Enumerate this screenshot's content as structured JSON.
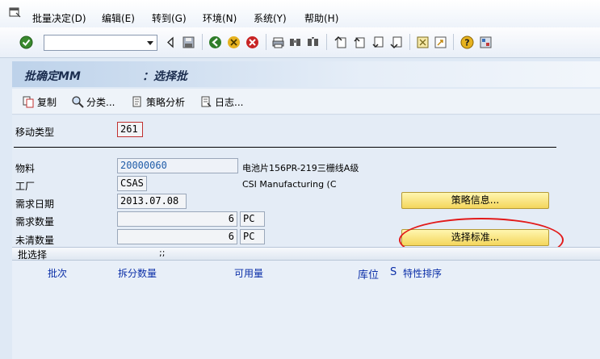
{
  "menu": {
    "items": [
      "批量决定(D)",
      "编辑(E)",
      "转到(G)",
      "环境(N)",
      "系统(Y)",
      "帮助(H)"
    ]
  },
  "toolbar": {
    "command_field": ""
  },
  "title": {
    "part1": "批确定MM",
    "part2": "：选择批"
  },
  "app_toolbar": {
    "copy": "复制",
    "classify": "分类...",
    "strategy_analysis": "策略分析",
    "log": "日志..."
  },
  "form": {
    "movement_type_label": "移动类型",
    "movement_type_value": "261",
    "material_label": "物料",
    "material_value": "20000060",
    "material_desc": "电池片156PR-219三栅线A级",
    "plant_label": "工厂",
    "plant_value": "CSAS",
    "plant_desc": "CSI Manufacturing (C",
    "req_date_label": "需求日期",
    "req_date_value": "2013.07.08",
    "req_qty_label": "需求数量",
    "req_qty_value": "6",
    "req_qty_unit": "PC",
    "open_qty_label": "未清数量",
    "open_qty_value": "6",
    "open_qty_unit": "PC"
  },
  "buttons": {
    "strategy_info": "策略信息...",
    "selection_criteria": "选择标准..."
  },
  "batch_selection": {
    "header": "批选择",
    "header_extra": ";;",
    "columns": [
      "批次",
      "拆分数量",
      "可用量",
      "库位",
      "S",
      "特性排序"
    ]
  },
  "colors": {
    "highlight_ellipse": "#e21a1a",
    "button_yellow": "#f4d65c",
    "column_header": "#0b2fa8"
  }
}
